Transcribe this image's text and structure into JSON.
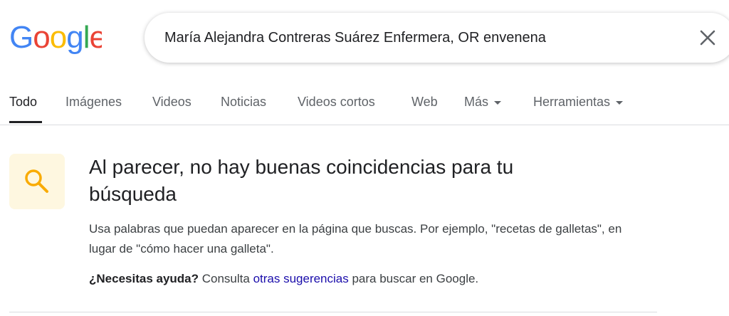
{
  "logo": {
    "text": "Google",
    "colors": [
      "#4285f4",
      "#ea4335",
      "#fbbc05",
      "#4285f4",
      "#34a853",
      "#ea4335"
    ]
  },
  "search": {
    "value": "María Alejandra Contreras Suárez Enfermera, OR envenena",
    "clear_icon": "close-icon"
  },
  "tabs": [
    {
      "label": "Todo",
      "active": true
    },
    {
      "label": "Imágenes"
    },
    {
      "label": "Videos"
    },
    {
      "label": "Noticias"
    },
    {
      "label": "Videos cortos"
    },
    {
      "label": "Web"
    },
    {
      "label": "Más",
      "dropdown": true
    },
    {
      "label": "Herramientas",
      "dropdown": true
    }
  ],
  "no_results": {
    "icon": "search-icon",
    "accent": "#f9ab00",
    "title": "Al parecer, no hay buenas coincidencias para tu búsqueda",
    "body": "Usa palabras que puedan aparecer en la página que buscas. Por ejemplo, \"recetas de galletas\", en lugar de \"cómo hacer una galleta\".",
    "help_bold": "¿Necesitas ayuda?",
    "help_pre": " Consulta ",
    "help_link": "otras sugerencias",
    "help_post": " para buscar en Google."
  }
}
